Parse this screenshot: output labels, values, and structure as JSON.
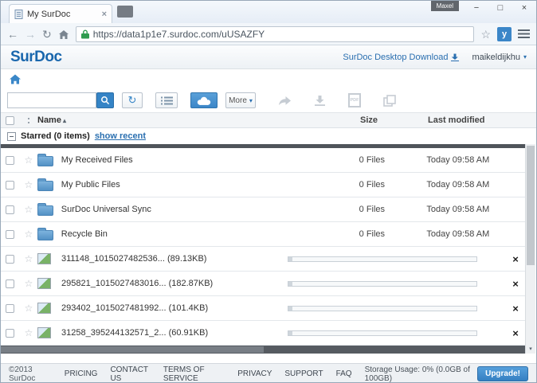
{
  "colors": {
    "brand_blue": "#1a67ad",
    "accent_blue": "#3584c6",
    "link_blue": "#2a6fb0",
    "upgrade_blue": "#3f8ed2",
    "lock_green": "#2e9b4e"
  },
  "browser": {
    "tab_title": "My SurDoc",
    "url": "https://data1p1e7.surdoc.com/uUSAZFY",
    "overlay_label": "Maxel",
    "extension_label": "y"
  },
  "header": {
    "logo": "SurDoc",
    "desktop_download": "SurDoc Desktop Download",
    "username": "maikeldijkhu"
  },
  "toolbar": {
    "more_label": "More",
    "pdf_label": "PDF"
  },
  "table": {
    "header": {
      "name": "Name",
      "size": "Size",
      "modified": "Last modified"
    },
    "starred_label": "Starred (0 items)",
    "show_recent_link": "show recent",
    "folders": [
      {
        "name": "My Received Files",
        "size": "0 Files",
        "modified": "Today 09:58 AM"
      },
      {
        "name": "My Public Files",
        "size": "0 Files",
        "modified": "Today 09:58 AM"
      },
      {
        "name": "SurDoc Universal Sync",
        "size": "0 Files",
        "modified": "Today 09:58 AM"
      },
      {
        "name": "Recycle Bin",
        "size": "0 Files",
        "modified": "Today 09:58 AM"
      }
    ],
    "uploads": [
      {
        "name": "311148_1015027482536... (89.13KB)"
      },
      {
        "name": "295821_1015027483016... (182.87KB)"
      },
      {
        "name": "293402_1015027481992... (101.4KB)"
      },
      {
        "name": "31258_395244132571_2... (60.91KB)"
      }
    ]
  },
  "footer": {
    "copyright": "©2013 SurDoc",
    "links": [
      "PRICING",
      "CONTACT US",
      "TERMS OF SERVICE",
      "PRIVACY",
      "SUPPORT",
      "FAQ"
    ],
    "storage_label": "Storage Usage:",
    "storage_value": "0% (0.0GB of 100GB)",
    "upgrade_label": "Upgrade!"
  }
}
